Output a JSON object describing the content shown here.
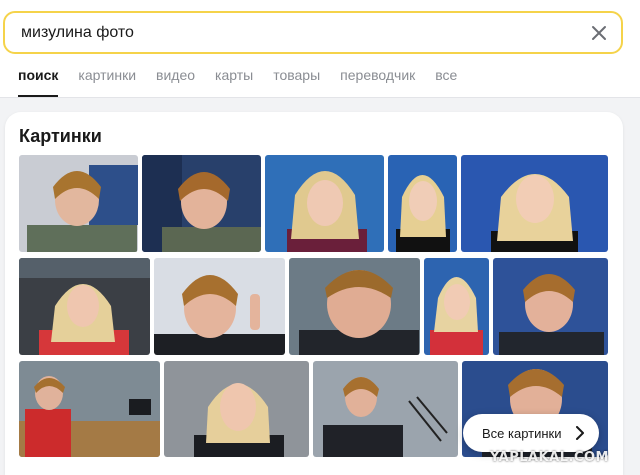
{
  "search": {
    "query": "мизулина фото"
  },
  "tabs": [
    {
      "label": "поиск"
    },
    {
      "label": "картинки"
    },
    {
      "label": "видео"
    },
    {
      "label": "карты"
    },
    {
      "label": "товары"
    },
    {
      "label": "переводчик"
    },
    {
      "label": "все"
    }
  ],
  "images_card": {
    "title": "Картинки",
    "all_button_label": "Все картинки"
  },
  "watermark": "YAPLAKAL.COM",
  "colors": {
    "search_border": "#f5d34a",
    "accent_text": "#1a1a1a",
    "muted_tab": "#8a8d93"
  }
}
